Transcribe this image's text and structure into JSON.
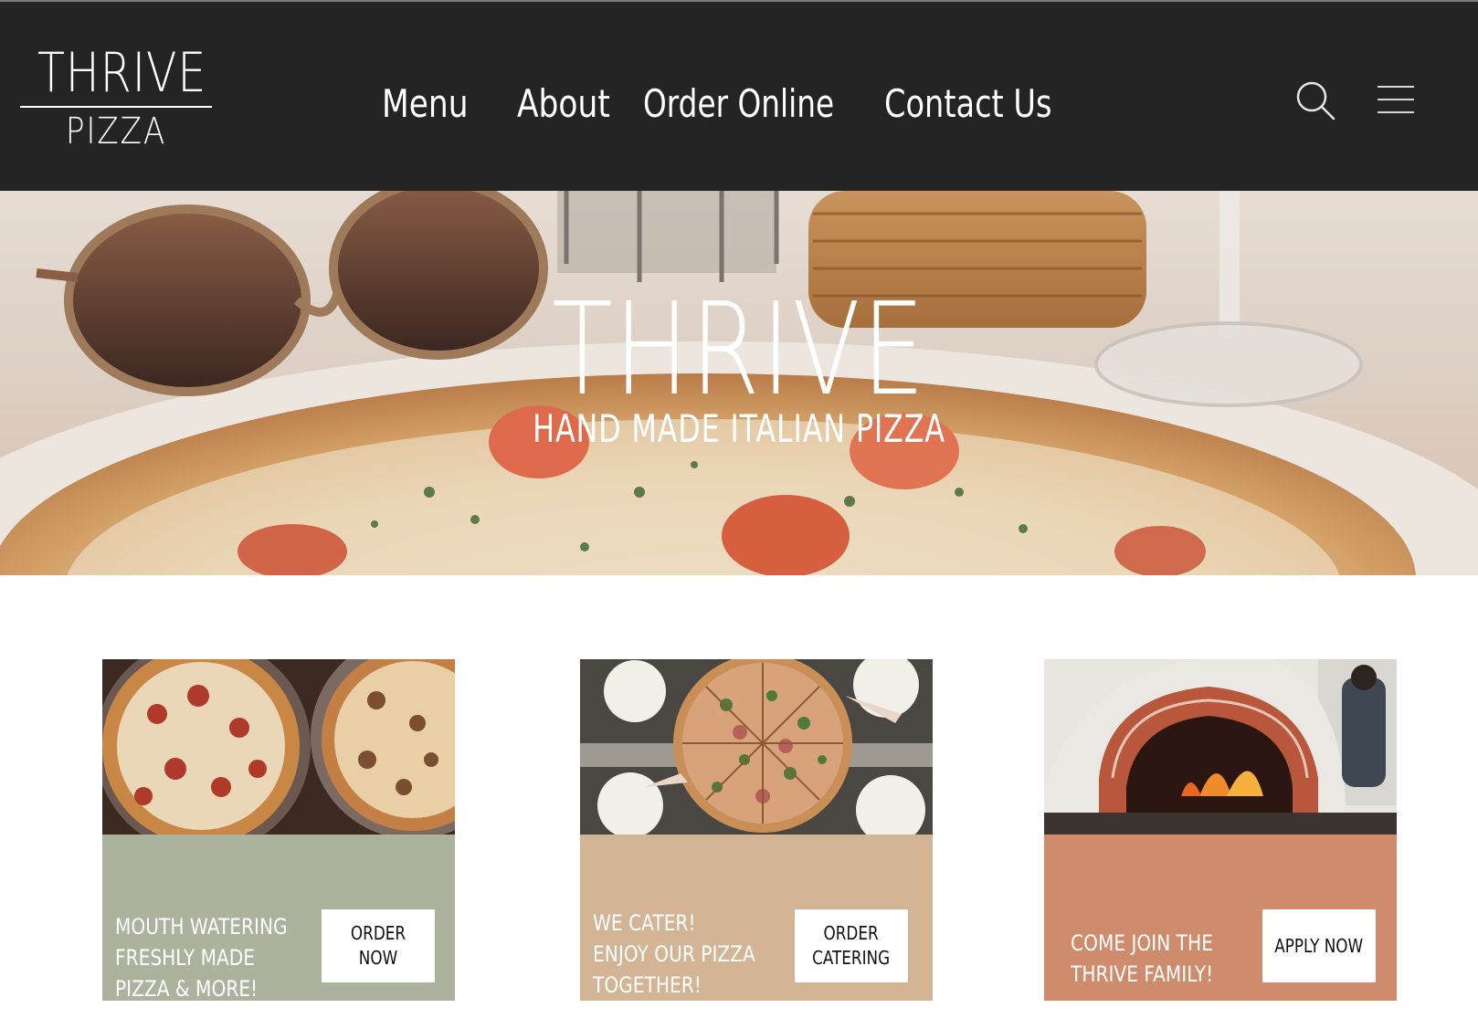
{
  "brand": {
    "logo_top": "THRIVE",
    "logo_bottom": "PIZZA"
  },
  "nav": {
    "items": [
      {
        "label": "Menu"
      },
      {
        "label": "About"
      },
      {
        "label": "Order Online"
      },
      {
        "label": "Contact Us"
      }
    ],
    "search_icon": "search-icon",
    "menu_icon": "hamburger-menu-icon"
  },
  "hero": {
    "title": "THRIVE",
    "subtitle": "HAND MADE ITALIAN PIZZA"
  },
  "cards": [
    {
      "text": "MOUTH WATERING\nFRESHLY MADE\nPIZZA & MORE!",
      "button": "ORDER NOW",
      "color": "#abb39f"
    },
    {
      "text": "WE CATER!\nENJOY OUR PIZZA\nTOGETHER!",
      "button": "ORDER\nCATERING",
      "color": "#d3b596"
    },
    {
      "text": "COME JOIN THE\nTHRIVE FAMILY!",
      "button": "APPLY NOW",
      "color": "#ce8c6d"
    }
  ],
  "colors": {
    "header_bg": "#252424",
    "text_light": "#ffffff"
  }
}
